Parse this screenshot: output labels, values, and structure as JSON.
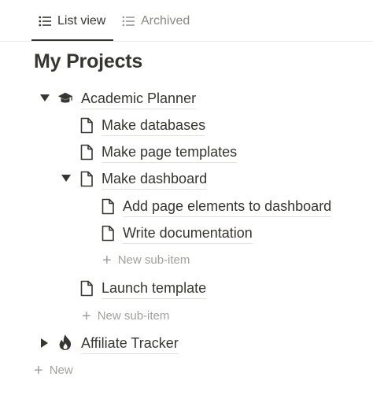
{
  "tabs": [
    {
      "label": "List view",
      "icon": "list-icon",
      "active": true
    },
    {
      "label": "Archived",
      "icon": "list-icon",
      "active": false
    }
  ],
  "title": "My Projects",
  "tree": {
    "academic": {
      "label": "Academic Planner",
      "icon": "graduation-cap-icon",
      "expanded": true
    },
    "make_databases": {
      "label": "Make databases",
      "icon": "page-icon"
    },
    "make_page_templates": {
      "label": "Make page templates",
      "icon": "page-icon"
    },
    "make_dashboard": {
      "label": "Make dashboard",
      "icon": "page-icon",
      "expanded": true
    },
    "add_page_elements": {
      "label": "Add page elements to dashboard",
      "icon": "page-icon"
    },
    "write_documentation": {
      "label": "Write documentation",
      "icon": "page-icon"
    },
    "new_sub_item_1": "New sub-item",
    "launch_template": {
      "label": "Launch template",
      "icon": "page-icon"
    },
    "new_sub_item_2": "New sub-item",
    "affiliate": {
      "label": "Affiliate Tracker",
      "icon": "fire-icon",
      "expanded": false
    }
  },
  "new_label": "New",
  "colors": {
    "text": "#37352f",
    "muted": "#8a8985",
    "placeholder": "#a19f9a",
    "divider": "#e9e9e7"
  }
}
